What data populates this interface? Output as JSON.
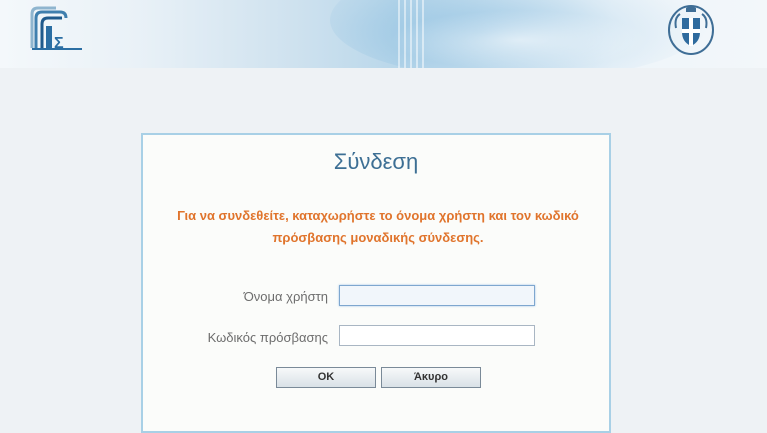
{
  "header": {
    "logo_left_icon": "gsis-logo-icon",
    "logo_right_icon": "greek-coat-of-arms-icon"
  },
  "login": {
    "title": "Σύνδεση",
    "instruction": "Για να συνδεθείτε, καταχωρήστε το όνομα χρήστη και τον κωδικό πρόσβασης μοναδικής σύνδεσης.",
    "username_label": "Όνομα χρήστη",
    "username_value": "",
    "password_label": "Κωδικός πρόσβασης",
    "password_value": "",
    "ok_label": "OK",
    "cancel_label": "Άκυρο"
  },
  "colors": {
    "title": "#3d6f94",
    "instruction": "#e0742c",
    "panel_border": "#a8d0e6"
  }
}
